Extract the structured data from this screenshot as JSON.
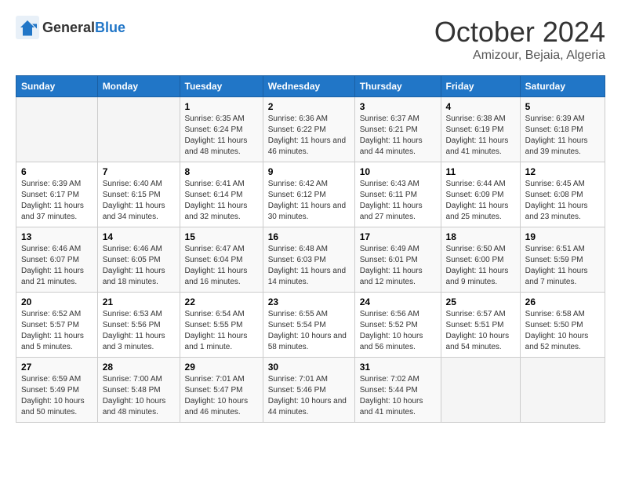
{
  "header": {
    "logo_general": "General",
    "logo_blue": "Blue",
    "month": "October 2024",
    "location": "Amizour, Bejaia, Algeria"
  },
  "weekdays": [
    "Sunday",
    "Monday",
    "Tuesday",
    "Wednesday",
    "Thursday",
    "Friday",
    "Saturday"
  ],
  "weeks": [
    [
      {
        "day": "",
        "info": ""
      },
      {
        "day": "",
        "info": ""
      },
      {
        "day": "1",
        "info": "Sunrise: 6:35 AM\nSunset: 6:24 PM\nDaylight: 11 hours and 48 minutes."
      },
      {
        "day": "2",
        "info": "Sunrise: 6:36 AM\nSunset: 6:22 PM\nDaylight: 11 hours and 46 minutes."
      },
      {
        "day": "3",
        "info": "Sunrise: 6:37 AM\nSunset: 6:21 PM\nDaylight: 11 hours and 44 minutes."
      },
      {
        "day": "4",
        "info": "Sunrise: 6:38 AM\nSunset: 6:19 PM\nDaylight: 11 hours and 41 minutes."
      },
      {
        "day": "5",
        "info": "Sunrise: 6:39 AM\nSunset: 6:18 PM\nDaylight: 11 hours and 39 minutes."
      }
    ],
    [
      {
        "day": "6",
        "info": "Sunrise: 6:39 AM\nSunset: 6:17 PM\nDaylight: 11 hours and 37 minutes."
      },
      {
        "day": "7",
        "info": "Sunrise: 6:40 AM\nSunset: 6:15 PM\nDaylight: 11 hours and 34 minutes."
      },
      {
        "day": "8",
        "info": "Sunrise: 6:41 AM\nSunset: 6:14 PM\nDaylight: 11 hours and 32 minutes."
      },
      {
        "day": "9",
        "info": "Sunrise: 6:42 AM\nSunset: 6:12 PM\nDaylight: 11 hours and 30 minutes."
      },
      {
        "day": "10",
        "info": "Sunrise: 6:43 AM\nSunset: 6:11 PM\nDaylight: 11 hours and 27 minutes."
      },
      {
        "day": "11",
        "info": "Sunrise: 6:44 AM\nSunset: 6:09 PM\nDaylight: 11 hours and 25 minutes."
      },
      {
        "day": "12",
        "info": "Sunrise: 6:45 AM\nSunset: 6:08 PM\nDaylight: 11 hours and 23 minutes."
      }
    ],
    [
      {
        "day": "13",
        "info": "Sunrise: 6:46 AM\nSunset: 6:07 PM\nDaylight: 11 hours and 21 minutes."
      },
      {
        "day": "14",
        "info": "Sunrise: 6:46 AM\nSunset: 6:05 PM\nDaylight: 11 hours and 18 minutes."
      },
      {
        "day": "15",
        "info": "Sunrise: 6:47 AM\nSunset: 6:04 PM\nDaylight: 11 hours and 16 minutes."
      },
      {
        "day": "16",
        "info": "Sunrise: 6:48 AM\nSunset: 6:03 PM\nDaylight: 11 hours and 14 minutes."
      },
      {
        "day": "17",
        "info": "Sunrise: 6:49 AM\nSunset: 6:01 PM\nDaylight: 11 hours and 12 minutes."
      },
      {
        "day": "18",
        "info": "Sunrise: 6:50 AM\nSunset: 6:00 PM\nDaylight: 11 hours and 9 minutes."
      },
      {
        "day": "19",
        "info": "Sunrise: 6:51 AM\nSunset: 5:59 PM\nDaylight: 11 hours and 7 minutes."
      }
    ],
    [
      {
        "day": "20",
        "info": "Sunrise: 6:52 AM\nSunset: 5:57 PM\nDaylight: 11 hours and 5 minutes."
      },
      {
        "day": "21",
        "info": "Sunrise: 6:53 AM\nSunset: 5:56 PM\nDaylight: 11 hours and 3 minutes."
      },
      {
        "day": "22",
        "info": "Sunrise: 6:54 AM\nSunset: 5:55 PM\nDaylight: 11 hours and 1 minute."
      },
      {
        "day": "23",
        "info": "Sunrise: 6:55 AM\nSunset: 5:54 PM\nDaylight: 10 hours and 58 minutes."
      },
      {
        "day": "24",
        "info": "Sunrise: 6:56 AM\nSunset: 5:52 PM\nDaylight: 10 hours and 56 minutes."
      },
      {
        "day": "25",
        "info": "Sunrise: 6:57 AM\nSunset: 5:51 PM\nDaylight: 10 hours and 54 minutes."
      },
      {
        "day": "26",
        "info": "Sunrise: 6:58 AM\nSunset: 5:50 PM\nDaylight: 10 hours and 52 minutes."
      }
    ],
    [
      {
        "day": "27",
        "info": "Sunrise: 6:59 AM\nSunset: 5:49 PM\nDaylight: 10 hours and 50 minutes."
      },
      {
        "day": "28",
        "info": "Sunrise: 7:00 AM\nSunset: 5:48 PM\nDaylight: 10 hours and 48 minutes."
      },
      {
        "day": "29",
        "info": "Sunrise: 7:01 AM\nSunset: 5:47 PM\nDaylight: 10 hours and 46 minutes."
      },
      {
        "day": "30",
        "info": "Sunrise: 7:01 AM\nSunset: 5:46 PM\nDaylight: 10 hours and 44 minutes."
      },
      {
        "day": "31",
        "info": "Sunrise: 7:02 AM\nSunset: 5:44 PM\nDaylight: 10 hours and 41 minutes."
      },
      {
        "day": "",
        "info": ""
      },
      {
        "day": "",
        "info": ""
      }
    ]
  ]
}
